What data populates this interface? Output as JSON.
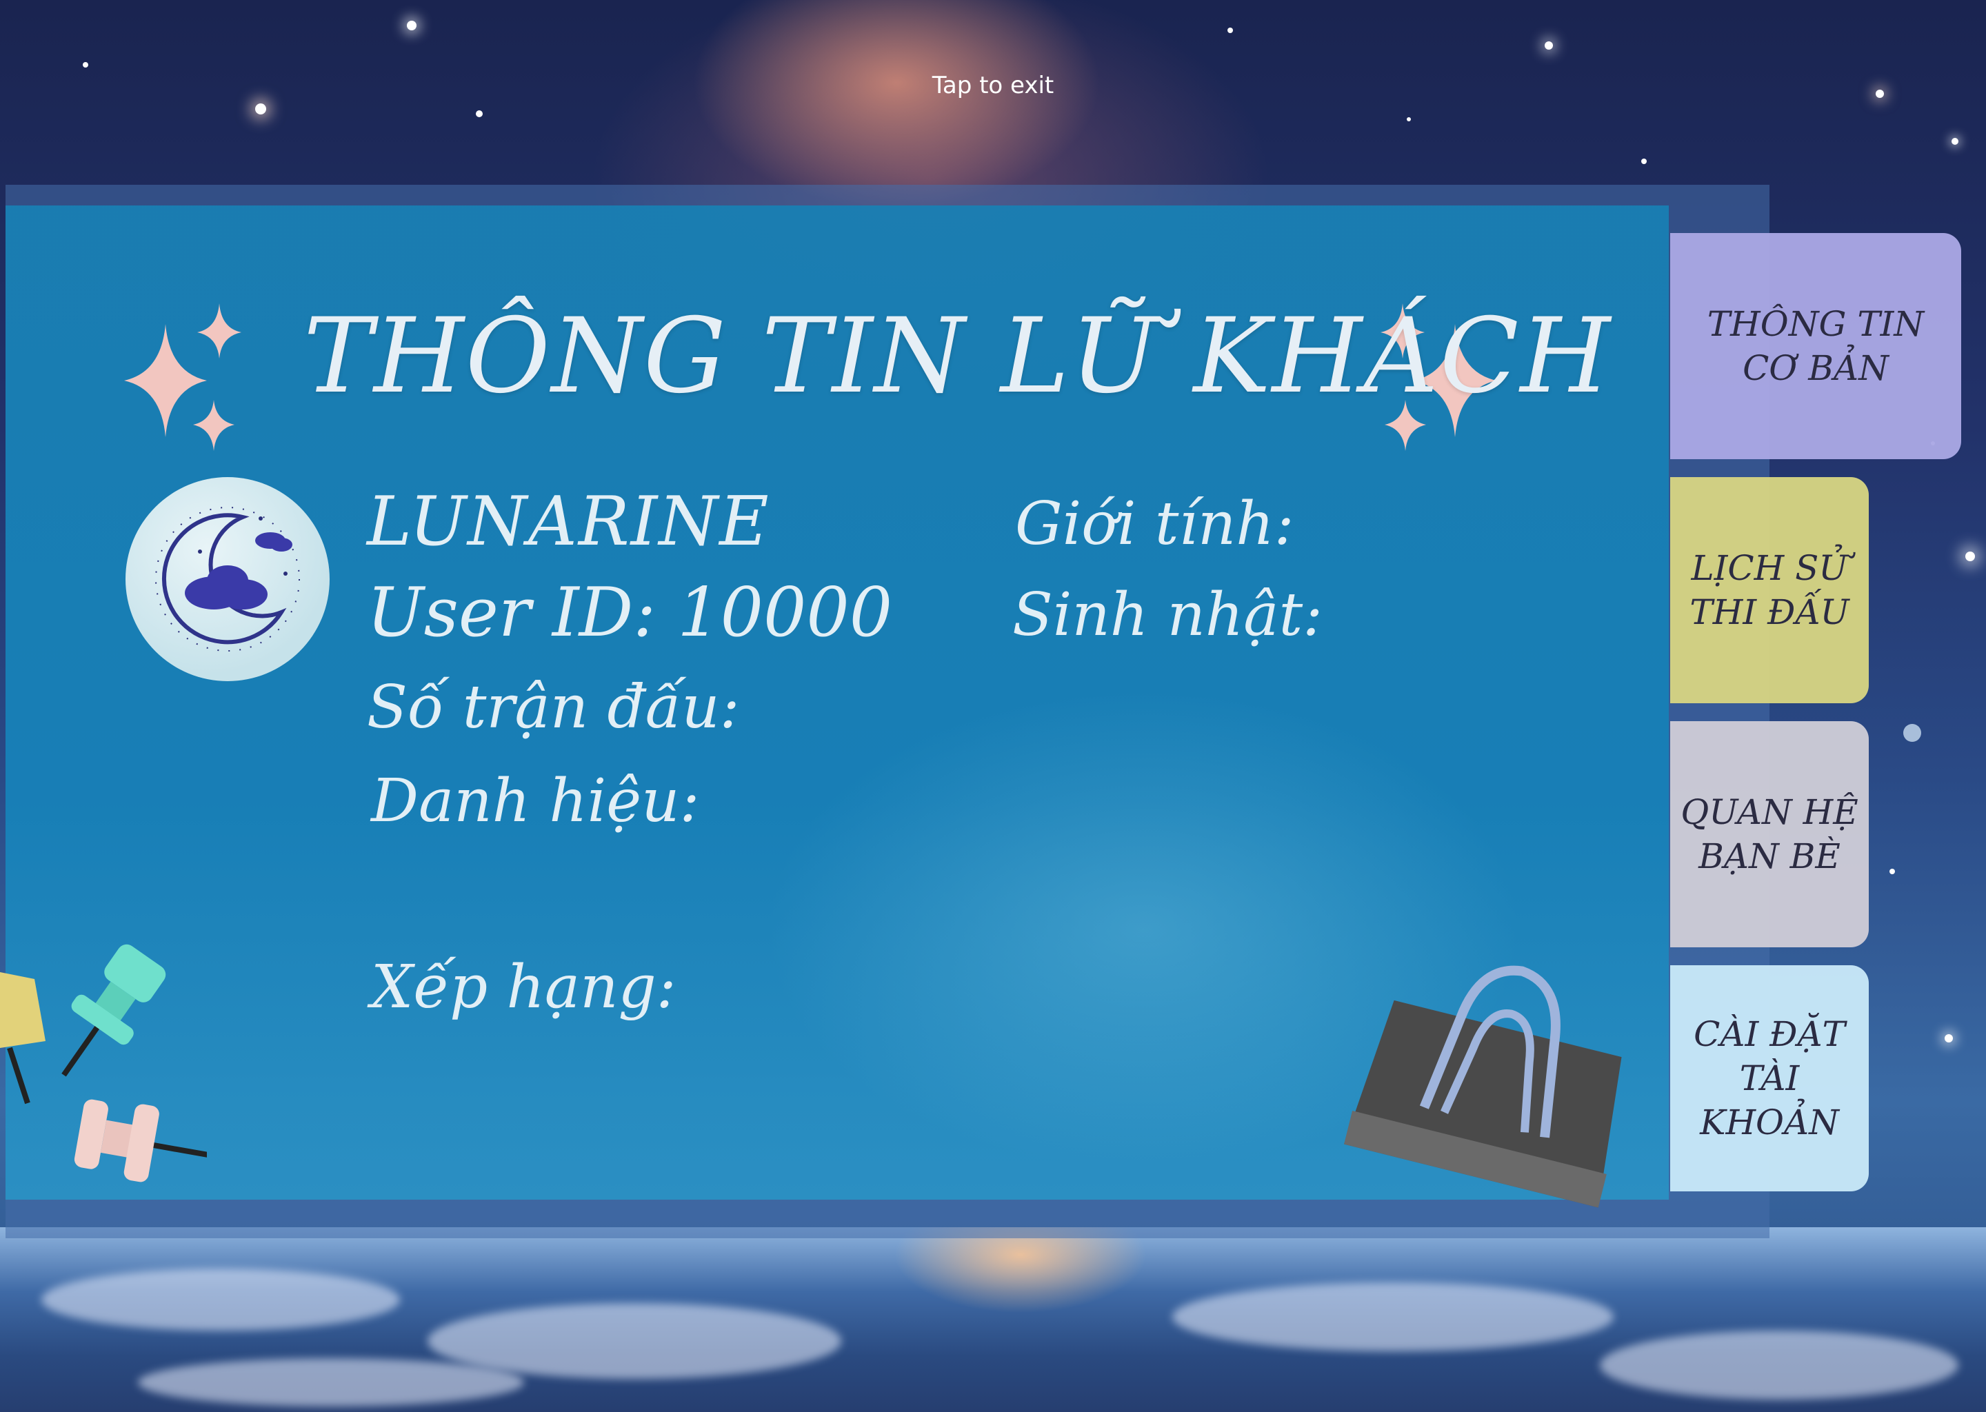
{
  "overlay": {
    "exit_hint": "Tap to exit"
  },
  "card": {
    "title": "THÔNG TIN LỮ KHÁCH",
    "username": "LUNARINE",
    "user_id": "User ID: 10000",
    "matches_label": "Số trận đấu:",
    "title_label": "Danh hiệu:",
    "rank_label": "Xếp hạng:",
    "gender_label": "Giới tính:",
    "birthday_label": "Sinh nhật:"
  },
  "tabs": [
    {
      "label": "THÔNG TIN\nCƠ BẢN",
      "color": "#aaa8e4",
      "active": true
    },
    {
      "label": "LỊCH SỬ\nTHI ĐẤU",
      "color": "#d6d482"
    },
    {
      "label": "QUAN HỆ\nBẠN BÈ",
      "color": "#ceccd6"
    },
    {
      "label": "CÀI ĐẶT\nTÀI KHOẢN",
      "color": "#c8e8f8"
    }
  ],
  "icons": {
    "avatar": "moon-cloud-icon",
    "sparkles": "sparkle-icon",
    "pins": "pushpin-icon",
    "clip": "binder-clip-icon"
  }
}
